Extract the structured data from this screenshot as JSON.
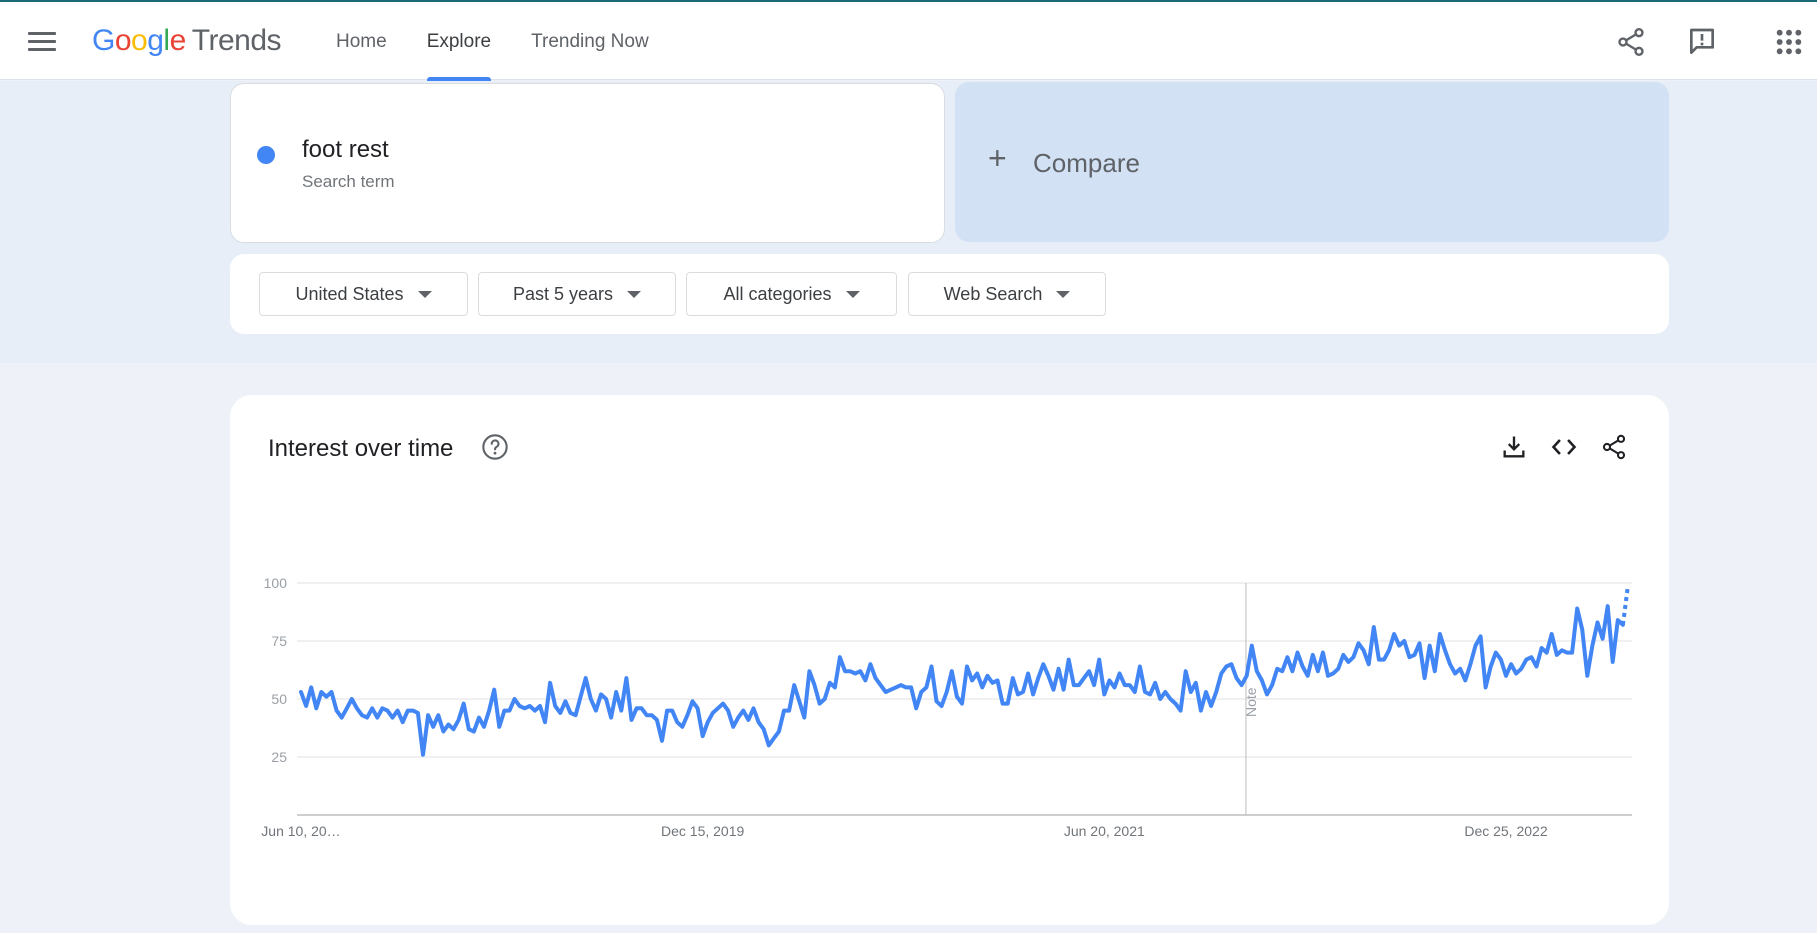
{
  "header": {
    "logo_letters": [
      "G",
      "o",
      "o",
      "g",
      "l",
      "e"
    ],
    "logo_suffix": "Trends",
    "tabs": [
      {
        "label": "Home",
        "active": false
      },
      {
        "label": "Explore",
        "active": true
      },
      {
        "label": "Trending Now",
        "active": false
      }
    ],
    "icons": [
      "menu-icon",
      "share-icon",
      "feedback-icon",
      "apps-grid-icon"
    ]
  },
  "search": {
    "term": "foot rest",
    "term_type": "Search term",
    "term_color": "#4285f4",
    "compare_label": "Compare"
  },
  "filters": {
    "region": "United States",
    "time_range": "Past 5 years",
    "category": "All categories",
    "search_type": "Web Search"
  },
  "chart_card": {
    "title": "Interest over time",
    "note_label": "Note",
    "icons": [
      "help-icon",
      "download-icon",
      "embed-code-icon",
      "share-icon"
    ]
  },
  "chart_data": {
    "type": "line",
    "title": "Interest over time",
    "xlabel": "",
    "ylabel": "",
    "ylim": [
      0,
      100
    ],
    "yticks": [
      25,
      50,
      75,
      100
    ],
    "x_tick_labels": [
      "Jun 10, 20…",
      "Dec 15, 2019",
      "Jun 20, 2021",
      "Dec 25, 2022"
    ],
    "x_start": "2018-06-10",
    "x_interval": "weekly",
    "note_date": "2022-01-01",
    "grid": true,
    "color": "#4285f4",
    "partial_last_point": true,
    "series": [
      {
        "values": [
          53,
          47,
          55,
          46,
          53,
          51,
          53,
          45,
          42,
          46,
          50,
          46,
          43,
          42,
          46,
          42,
          46,
          45,
          42,
          45,
          40,
          45,
          45,
          44,
          26,
          43,
          38,
          43,
          36,
          39,
          37,
          41,
          48,
          37,
          36,
          42,
          38,
          45,
          54,
          38,
          45,
          45,
          50,
          47,
          46,
          47,
          45,
          47,
          40,
          57,
          47,
          44,
          49,
          44,
          43,
          51,
          59,
          50,
          45,
          52,
          50,
          42,
          53,
          45,
          59,
          41,
          46,
          46,
          43,
          43,
          41,
          32,
          45,
          45,
          40,
          38,
          43,
          49,
          46,
          34,
          40,
          44,
          46,
          48,
          45,
          38,
          42,
          45,
          41,
          46,
          40,
          37,
          30,
          33,
          36,
          45,
          45,
          56,
          49,
          42,
          62,
          56,
          48,
          50,
          57,
          55,
          68,
          62,
          62,
          61,
          62,
          58,
          65,
          59,
          56,
          53,
          54,
          55,
          56,
          55,
          55,
          46,
          53,
          55,
          64,
          49,
          47,
          53,
          62,
          51,
          48,
          64,
          58,
          61,
          55,
          60,
          57,
          58,
          48,
          48,
          59,
          52,
          53,
          61,
          52,
          59,
          65,
          60,
          54,
          63,
          54,
          67,
          56,
          56,
          59,
          62,
          56,
          67,
          52,
          58,
          55,
          61,
          56,
          56,
          53,
          64,
          53,
          52,
          57,
          50,
          53,
          50,
          48,
          45,
          62,
          53,
          57,
          45,
          53,
          47,
          53,
          61,
          64,
          65,
          59,
          56,
          60,
          73,
          62,
          58,
          52,
          56,
          63,
          62,
          68,
          62,
          70,
          64,
          60,
          69,
          62,
          70,
          60,
          61,
          63,
          69,
          66,
          68,
          74,
          71,
          65,
          81,
          67,
          67,
          71,
          78,
          73,
          75,
          68,
          69,
          74,
          59,
          73,
          62,
          78,
          71,
          65,
          61,
          63,
          58,
          65,
          73,
          77,
          55,
          64,
          70,
          67,
          60,
          65,
          61,
          63,
          67,
          68,
          64,
          72,
          70,
          78,
          69,
          71,
          70,
          70,
          89,
          80,
          60,
          73,
          83,
          76,
          90,
          66,
          84,
          82,
          99
        ]
      }
    ]
  }
}
